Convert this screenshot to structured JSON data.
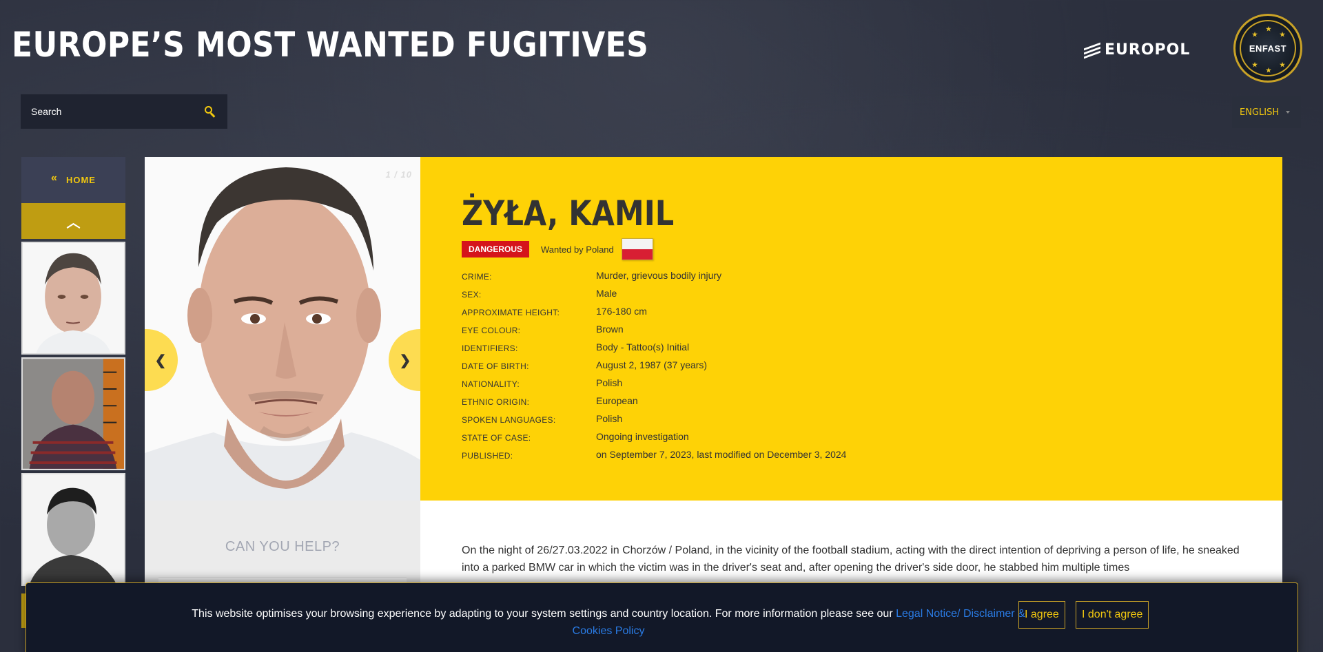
{
  "header": {
    "site_title": "EUROPE’S MOST WANTED FUGITIVES",
    "europol_logo_text": "EUROPOL",
    "enfast_logo_text": "ENFAST"
  },
  "search": {
    "placeholder": "Search",
    "icon": "search-icon"
  },
  "language": {
    "selected": "ENGLISH"
  },
  "sidebar": {
    "home_label": "HOME",
    "home_icon": "double-chevron-left-icon",
    "scroll_up_icon": "chevron-up-icon",
    "thumbnails": [
      "fugitive-photo-1",
      "fugitive-photo-2",
      "fugitive-photo-3"
    ]
  },
  "profile": {
    "counter": "1 / 10",
    "name": "ŻYŁA, KAMIL",
    "danger_badge": "DANGEROUS",
    "wanted_by": "Wanted by Poland",
    "flag": "poland-flag",
    "details": [
      {
        "label": "CRIME:",
        "value": "Murder, grievous bodily injury"
      },
      {
        "label": "SEX:",
        "value": "Male"
      },
      {
        "label": "APPROXIMATE HEIGHT:",
        "value": "176-180 cm"
      },
      {
        "label": "EYE COLOUR:",
        "value": "Brown"
      },
      {
        "label": "IDENTIFIERS:",
        "value": "Body - Tattoo(s) Initial"
      },
      {
        "label": "DATE OF BIRTH:",
        "value": "August 2, 1987 (37 years)"
      },
      {
        "label": "NATIONALITY:",
        "value": "Polish"
      },
      {
        "label": "ETHNIC ORIGIN:",
        "value": "European"
      },
      {
        "label": "SPOKEN LANGUAGES:",
        "value": "Polish"
      },
      {
        "label": "STATE OF CASE:",
        "value": "Ongoing investigation"
      },
      {
        "label": "PUBLISHED:",
        "value": "on September 7, 2023, last modified on December 3, 2024"
      }
    ]
  },
  "help": {
    "title": "CAN YOU HELP?"
  },
  "description": {
    "text": "On the night of 26/27.03.2022 in Chorzów / Poland, in the vicinity of the football stadium, acting with the direct intention of depriving a person of life, he sneaked into a parked BMW car in which the victim was in the driver's seat and, after opening the driver's side door, he stabbed him multiple times"
  },
  "cookie": {
    "text": "This website optimises your browsing experience by adapting to your system settings and country location. For more information please see our ",
    "link_text": "Legal Notice/ Disclaimer & Cookies Policy",
    "agree_label": "I agree",
    "disagree_label": "I don't agree"
  },
  "colors": {
    "accent_yellow": "#fed206",
    "danger_red": "#d5141b",
    "link_blue": "#2a7be4",
    "background": "#2b2f3d"
  }
}
